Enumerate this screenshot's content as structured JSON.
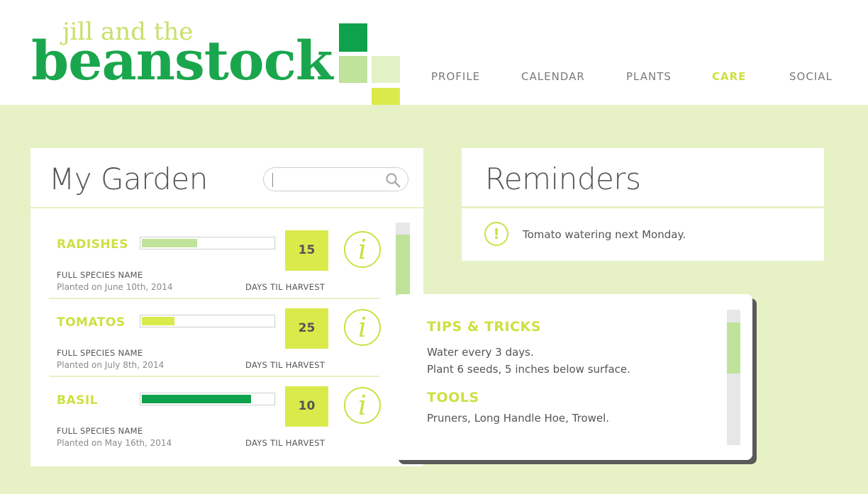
{
  "logo": {
    "small": "jill and the",
    "big": "beanstock"
  },
  "nav": {
    "items": [
      {
        "label": "PROFILE",
        "active": false
      },
      {
        "label": "CALENDAR",
        "active": false
      },
      {
        "label": "PLANTS",
        "active": false
      },
      {
        "label": "CARE",
        "active": true
      },
      {
        "label": "SOCIAL",
        "active": false
      }
    ]
  },
  "colors": {
    "accent_green": "#1aa64d",
    "lime": "#cde042",
    "pale_green_bg": "#e6f1c6",
    "progress_light": "#bfe39a",
    "progress_lime": "#daea4b",
    "progress_dark": "#0fa24c"
  },
  "garden": {
    "title": "My Garden",
    "search": {
      "value": "",
      "placeholder": ""
    },
    "plants": [
      {
        "name": "RADISHES",
        "progress": 0.42,
        "progress_color": "#bfe39a",
        "days": "15",
        "species": "FULL SPECIES NAME",
        "planted": "Planted on June 10th, 2014",
        "days_label": "DAYS TIL HARVEST"
      },
      {
        "name": "TOMATOS",
        "progress": 0.25,
        "progress_color": "#daea4b",
        "days": "25",
        "species": "FULL SPECIES NAME",
        "planted": "Planted on July 8th, 2014",
        "days_label": "DAYS TIL HARVEST"
      },
      {
        "name": "BASIL",
        "progress": 0.83,
        "progress_color": "#0fa24c",
        "days": "10",
        "species": "FULL SPECIES NAME",
        "planted": "Planted on May 16th, 2014",
        "days_label": "DAYS TIL HARVEST"
      }
    ],
    "info_symbol": "i"
  },
  "reminders": {
    "title": "Reminders",
    "icon_symbol": "!",
    "items": [
      {
        "text": "Tomato watering next Monday."
      }
    ]
  },
  "tips": {
    "tips_heading": "TIPS & TRICKS",
    "tips_lines": [
      "Water every 3 days.",
      "Plant 6 seeds, 5 inches below surface."
    ],
    "tools_heading": "TOOLS",
    "tools_lines": [
      "Pruners, Long Handle Hoe, Trowel."
    ]
  }
}
